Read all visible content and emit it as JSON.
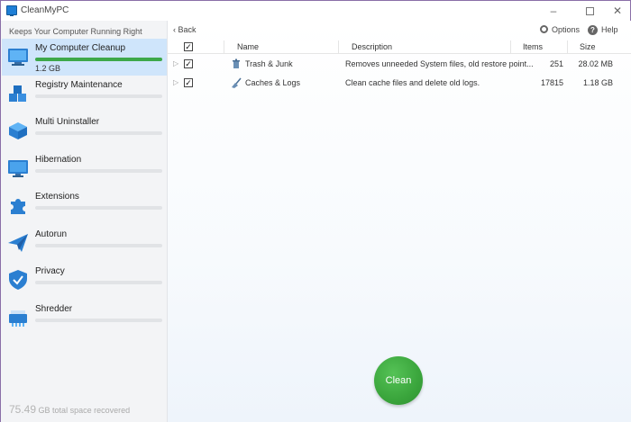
{
  "window": {
    "title": "CleanMyPC",
    "minimize": "–",
    "close": "✕"
  },
  "sidebar": {
    "tagline": "Keeps Your Computer Running Right",
    "items": [
      {
        "label": "My Computer Cleanup",
        "sub": "1.2 GB",
        "progress": 1.0,
        "active": true,
        "icon": "computer-icon"
      },
      {
        "label": "Registry Maintenance",
        "progress": 0,
        "icon": "registry-cubes-icon"
      },
      {
        "label": "Multi Uninstaller",
        "progress": 0,
        "icon": "uninstaller-box-icon"
      },
      {
        "label": "Hibernation",
        "progress": 0,
        "icon": "monitor-icon"
      },
      {
        "label": "Extensions",
        "progress": 0,
        "icon": "puzzle-icon"
      },
      {
        "label": "Autorun",
        "progress": 0,
        "icon": "paper-plane-icon"
      },
      {
        "label": "Privacy",
        "progress": 0,
        "icon": "shield-icon"
      },
      {
        "label": "Shredder",
        "progress": 0,
        "icon": "shredder-icon"
      }
    ],
    "footer": {
      "amount": "75.49",
      "text": "GB total space recovered"
    }
  },
  "toolbar": {
    "back_label": "Back",
    "options_label": "Options",
    "help_label": "Help"
  },
  "table": {
    "columns": {
      "name": "Name",
      "description": "Description",
      "items": "Items",
      "size": "Size"
    },
    "rows": [
      {
        "name": "Trash & Junk",
        "description": "Removes unneeded System files, old restore point...",
        "items": "251",
        "size": "28.02 MB",
        "checked": true
      },
      {
        "name": "Caches & Logs",
        "description": "Clean cache files and delete old logs.",
        "items": "17815",
        "size": "1.18 GB",
        "checked": true
      }
    ]
  },
  "actions": {
    "clean_label": "Clean"
  },
  "colors": {
    "accent": "#3ea84a",
    "active_bg": "#cfe5fb",
    "clean_button": "#3aa53c"
  }
}
